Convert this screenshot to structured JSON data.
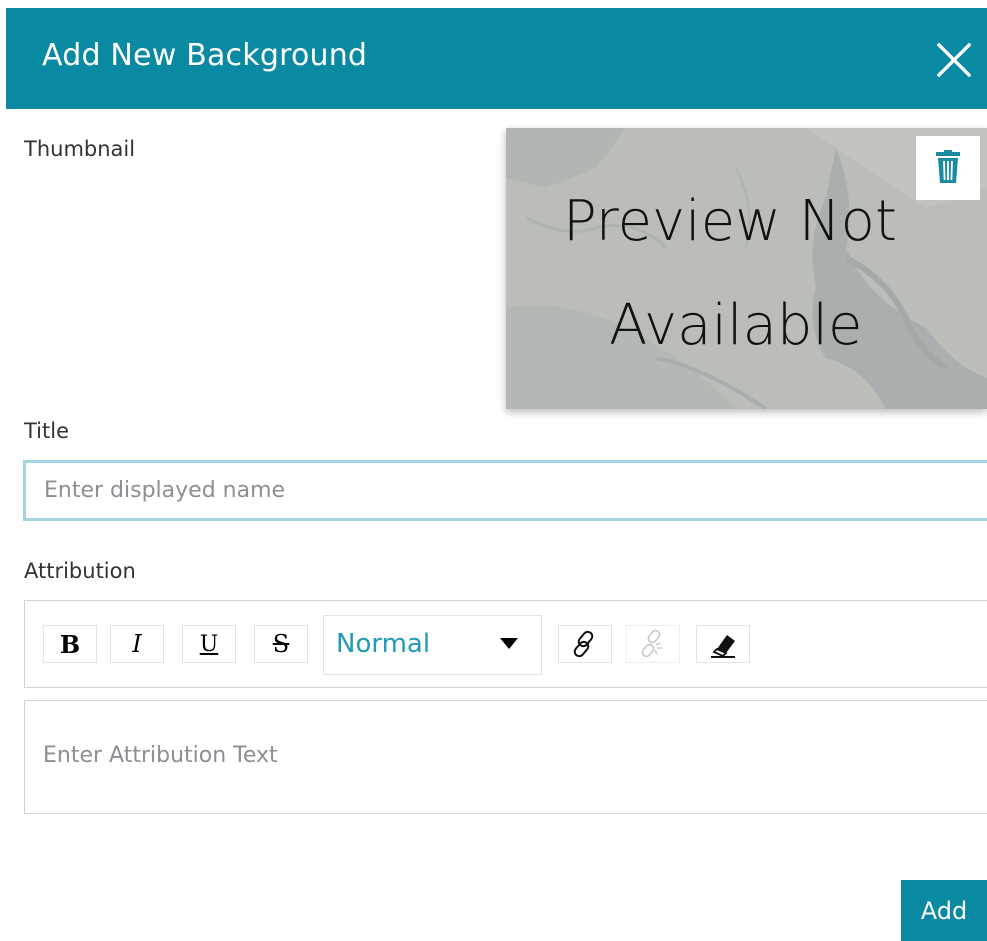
{
  "dialog": {
    "title": "Add New Background",
    "close_icon": "close-icon"
  },
  "thumbnail": {
    "label": "Thumbnail",
    "preview_line1": "Preview Not",
    "preview_line2": "Available",
    "delete_icon": "trash-icon"
  },
  "title_field": {
    "label": "Title",
    "placeholder": "Enter displayed name",
    "value": ""
  },
  "attribution": {
    "label": "Attribution",
    "toolbar": {
      "bold": "B",
      "italic": "I",
      "underline": "U",
      "strike": "S",
      "format_selected": "Normal",
      "link_icon": "link-icon",
      "unlink_icon": "unlink-icon",
      "clean_icon": "eraser-icon"
    },
    "placeholder": "Enter Attribution Text"
  },
  "actions": {
    "add_label": "Add"
  },
  "colors": {
    "header": "#0a89a2",
    "accent_text": "#1f9bb5",
    "input_border": "#a4d4dd"
  }
}
